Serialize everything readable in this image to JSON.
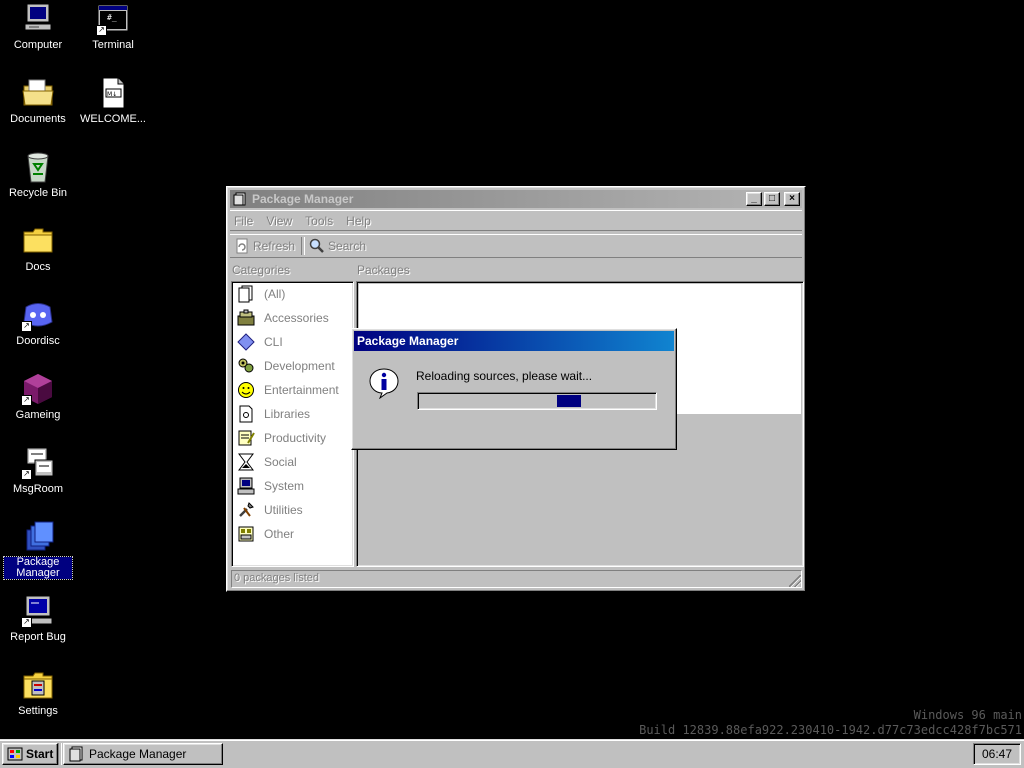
{
  "desktop": {
    "icons": [
      {
        "label": "Computer",
        "icon": "computer-icon"
      },
      {
        "label": "Terminal",
        "icon": "terminal-icon"
      },
      {
        "label": "Documents",
        "icon": "documents-folder-icon"
      },
      {
        "label": "WELCOME...",
        "icon": "markdown-file-icon"
      },
      {
        "label": "Recycle Bin",
        "icon": "recycle-bin-icon"
      },
      {
        "label": "Docs",
        "icon": "folder-icon"
      },
      {
        "label": "Doordisc",
        "icon": "doordisc-icon"
      },
      {
        "label": "Gameing",
        "icon": "game-cube-icon"
      },
      {
        "label": "MsgRoom",
        "icon": "msgroom-icon"
      },
      {
        "label": "Package Manager",
        "icon": "package-manager-icon"
      },
      {
        "label": "Report Bug",
        "icon": "report-bug-icon"
      },
      {
        "label": "Settings",
        "icon": "settings-icon"
      }
    ]
  },
  "window": {
    "title": "Package Manager",
    "controls": {
      "minimize": "_",
      "maximize": "□",
      "close": "×"
    },
    "menu": [
      "File",
      "View",
      "Tools",
      "Help"
    ],
    "toolbar": {
      "refresh": "Refresh",
      "search": "Search"
    },
    "categories_label": "Categories",
    "packages_label": "Packages",
    "categories": [
      {
        "label": "(All)",
        "icon": "all-icon"
      },
      {
        "label": "Accessories",
        "icon": "accessories-icon"
      },
      {
        "label": "CLI",
        "icon": "cli-icon"
      },
      {
        "label": "Development",
        "icon": "development-icon"
      },
      {
        "label": "Entertainment",
        "icon": "entertainment-icon"
      },
      {
        "label": "Libraries",
        "icon": "libraries-icon"
      },
      {
        "label": "Productivity",
        "icon": "productivity-icon"
      },
      {
        "label": "Social",
        "icon": "social-icon"
      },
      {
        "label": "System",
        "icon": "system-icon"
      },
      {
        "label": "Utilities",
        "icon": "utilities-icon"
      },
      {
        "label": "Other",
        "icon": "other-icon"
      }
    ],
    "status": "0 packages listed"
  },
  "dialog": {
    "title": "Package Manager",
    "message": "Reloading sources, please wait...",
    "icon": "info-icon",
    "progress_position": 0.65,
    "progress_block_fraction": 0.1
  },
  "watermark": {
    "line1": "Windows 96 main",
    "line2": "Build 12839.88efa922.230410-1942.d77c73edcc428f7bc571"
  },
  "taskbar": {
    "start_label": "Start",
    "tasks": [
      {
        "label": "Package Manager"
      }
    ],
    "clock": "06:47"
  },
  "colors": {
    "desktop": "#000000",
    "face": "#c0c0c0",
    "active_title": "#000080",
    "selection": "#000080"
  }
}
